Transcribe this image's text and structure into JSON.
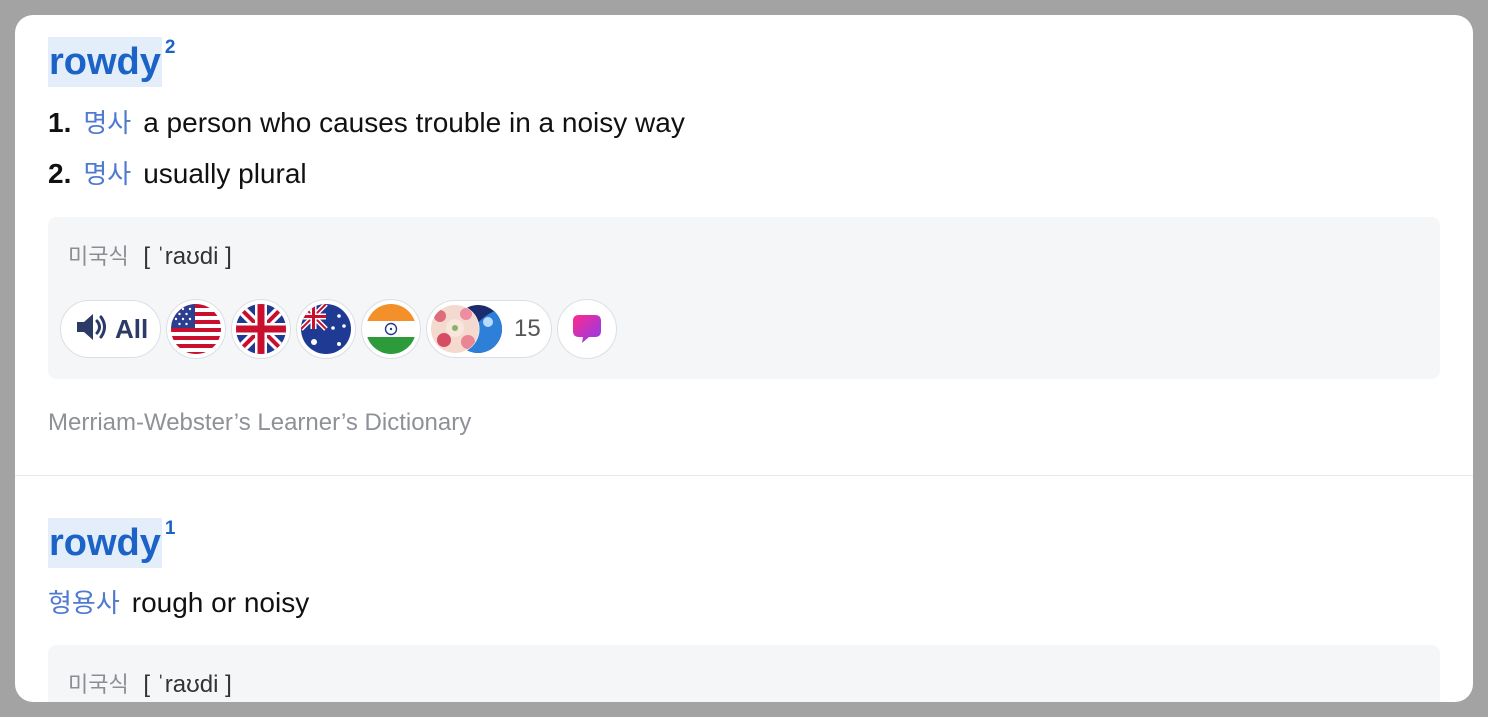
{
  "entries": [
    {
      "headword": "rowdy",
      "superscript": "2",
      "senses": [
        {
          "num": "1.",
          "pos": "명사",
          "definition": "a person who causes trouble in a noisy way"
        },
        {
          "num": "2.",
          "pos": "명사",
          "definition": "usually plural"
        }
      ],
      "pronunciation": {
        "region": "미국식",
        "ipa": "[ ˈraʊdi ]"
      },
      "audio": {
        "all_label": "All",
        "flags": [
          "us-flag",
          "uk-flag",
          "australia-flag",
          "india-flag"
        ],
        "more_count": "15"
      },
      "source": "Merriam-Webster’s Learner’s Dictionary"
    },
    {
      "headword": "rowdy",
      "superscript": "1",
      "pos": "형용사",
      "definition": "rough or noisy",
      "pronunciation": {
        "region": "미국식",
        "ipa": "[ ˈraʊdi ]"
      }
    }
  ],
  "colors": {
    "headword": "#1b63c6",
    "headword_bg": "#e4eefa",
    "pos": "#4f7ad0",
    "panel_bg": "#f5f6f8",
    "overlay": "#a3a3a3"
  }
}
